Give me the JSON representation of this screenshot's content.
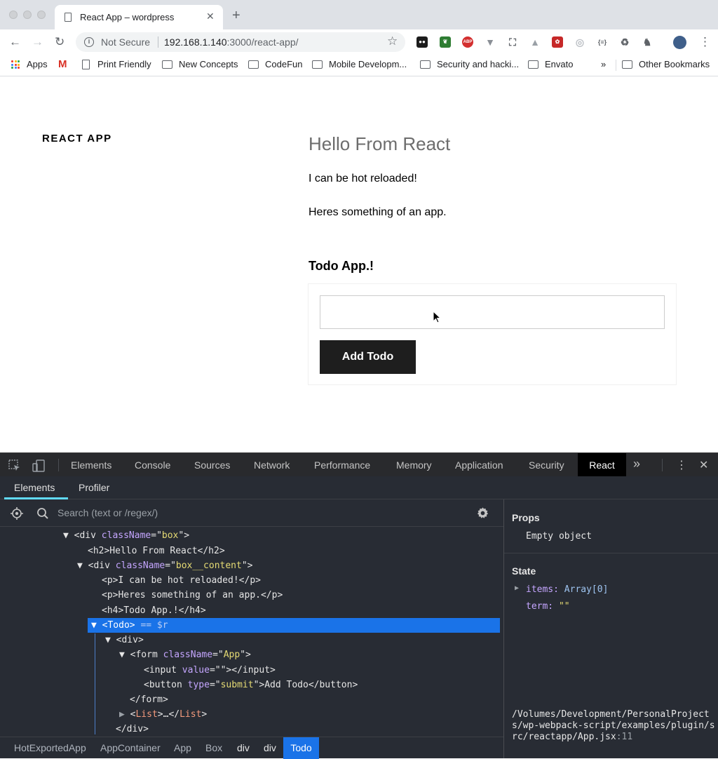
{
  "browser": {
    "tab_title": "React App – wordpress",
    "security_label": "Not Secure",
    "url_host": "192.168.1.140",
    "url_path": ":3000/react-app/",
    "bookmarks": {
      "apps": "Apps",
      "print_friendly": "Print Friendly",
      "new_concepts": "New Concepts",
      "codefun": "CodeFun",
      "mobile_dev": "Mobile Developm...",
      "security": "Security and hacki...",
      "envato": "Envato",
      "more": "»",
      "other": "Other Bookmarks"
    },
    "ext_abp": "ABP",
    "ext_json": "{≡}"
  },
  "page": {
    "site_title": "REACT APP",
    "heading": "Hello From React",
    "paragraph1": "I can be hot reloaded!",
    "paragraph2": "Heres something of an app.",
    "todo_heading": "Todo App.!",
    "add_button": "Add Todo",
    "input_value": ""
  },
  "devtools": {
    "tabs": [
      "Elements",
      "Console",
      "Sources",
      "Network",
      "Performance",
      "Memory",
      "Application",
      "Security",
      "React"
    ],
    "overflow": "»",
    "react_subtabs": [
      "Elements",
      "Profiler"
    ],
    "search_placeholder": "Search (text or /regex/)",
    "tree": {
      "l1": [
        "▼ ",
        "<div ",
        "className",
        "=\"",
        "box",
        "\">"
      ],
      "l2": "<h2>Hello From React</h2>",
      "l3": [
        "▼ ",
        "<div ",
        "className",
        "=\"",
        "box__content",
        "\">"
      ],
      "l4": "<p>I can be hot reloaded!</p>",
      "l5": "<p>Heres something of an app.</p>",
      "l6": "<h4>Todo App.!</h4>",
      "l7": [
        "▼ ",
        "<Todo>",
        " == $r"
      ],
      "l8": "▼ <div>",
      "l9": [
        "▼ ",
        "<form ",
        "className",
        "=\"",
        "App",
        "\">"
      ],
      "l10": [
        "<input ",
        "value",
        "=\"",
        "\"></input>"
      ],
      "l11": [
        "<button ",
        "type",
        "=\"",
        "submit",
        "\">Add Todo</button>"
      ],
      "l12": "</form>",
      "l13": [
        "▶ ",
        "<",
        "List",
        ">…</",
        "List",
        ">"
      ],
      "l14": "</div>"
    },
    "breadcrumbs": [
      "HotExportedApp",
      "AppContainer",
      "App",
      "Box",
      "div",
      "div",
      "Todo"
    ],
    "props_title": "Props",
    "props_empty": "Empty object",
    "state_title": "State",
    "state_items_key": "items:",
    "state_items_val": "Array[0]",
    "state_term_key": "term:",
    "state_term_val": "\"\"",
    "source_path": "/Volumes/Development/PersonalProjects/wp-webpack-script/examples/plugin/src/reactapp/App.jsx",
    "source_line": ":11"
  },
  "colors": {
    "react_accent": "#61dafb",
    "selection": "#1a73e8",
    "devtools_bg": "#282c34"
  }
}
